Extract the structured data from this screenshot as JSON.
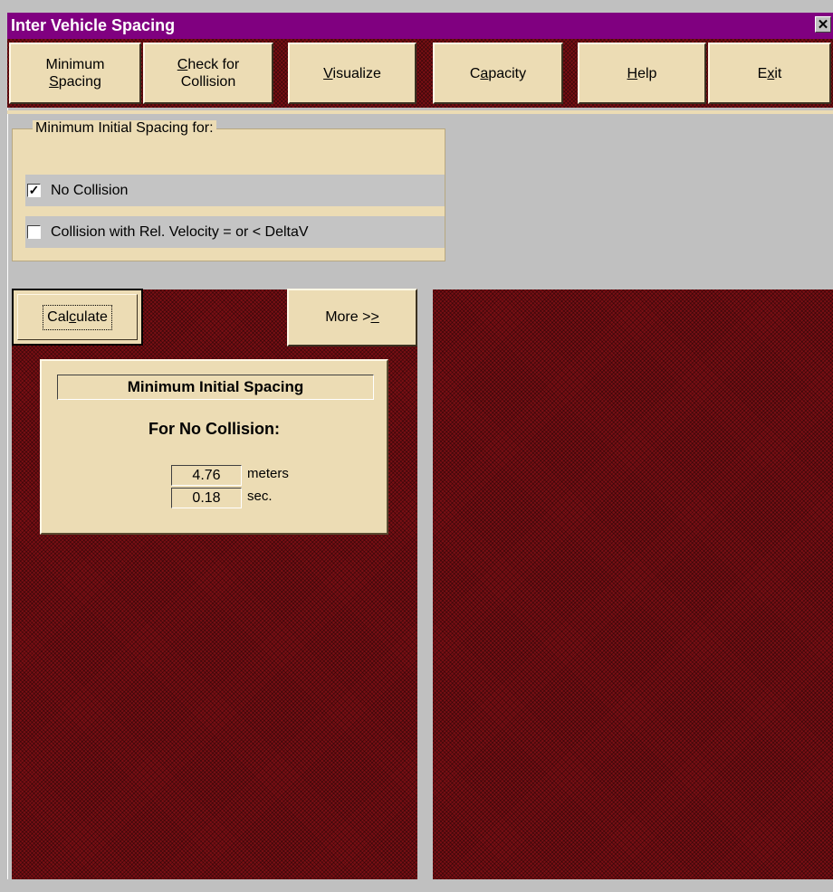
{
  "window": {
    "title": "Inter Vehicle Spacing",
    "close_glyph": "✕"
  },
  "toolbar": {
    "buttons": [
      {
        "label": "Minimum\nSpacing",
        "underline": "S"
      },
      {
        "label": "Check for\nCollision",
        "underline": "C"
      },
      {
        "label": "Visualize",
        "underline": "V"
      },
      {
        "label": "Capacity",
        "underline": "a"
      },
      {
        "label": "Help",
        "underline": "H"
      },
      {
        "label": "Exit",
        "underline": "x"
      }
    ]
  },
  "group": {
    "legend": "Minimum Initial Spacing for:",
    "options": [
      {
        "label": "No Collision",
        "checked": true
      },
      {
        "label": "Collision with Rel. Velocity = or < DeltaV",
        "checked": false
      }
    ]
  },
  "actions": {
    "calculate": "Calculate",
    "more": "More >>"
  },
  "result": {
    "title": "Minimum Initial Spacing",
    "subtitle": "For No Collision:",
    "distance_value": "4.76",
    "distance_unit": "meters",
    "time_value": "0.18",
    "time_unit": "sec."
  },
  "colors": {
    "title_bar": "#800080",
    "button_face": "#ecdcb4",
    "pattern": "#7a0f14",
    "background": "#c0c0c0"
  }
}
